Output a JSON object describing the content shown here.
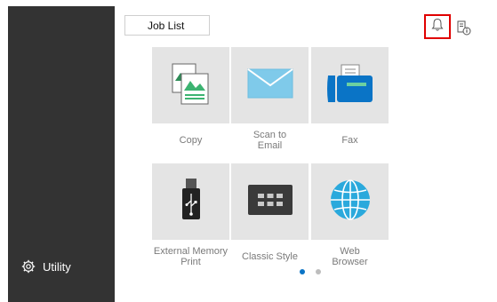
{
  "toolbar": {
    "job_list_label": "Job List"
  },
  "tiles": [
    {
      "label_lines": [
        "Copy"
      ],
      "icon": "copy-icon"
    },
    {
      "label_lines": [
        "Scan to",
        "Email"
      ],
      "icon": "mail-icon"
    },
    {
      "label_lines": [
        "Fax"
      ],
      "icon": "fax-icon"
    },
    {
      "label_lines": [
        "External Memory",
        "Print"
      ],
      "icon": "usb-icon"
    },
    {
      "label_lines": [
        "Classic Style"
      ],
      "icon": "classic-style-icon"
    },
    {
      "label_lines": [
        "Web",
        "Browser"
      ],
      "icon": "globe-icon"
    }
  ],
  "sidebar": {
    "utility_label": "Utility"
  },
  "pager": {
    "pages": 2,
    "current": 1
  },
  "colors": {
    "sidebar": "#333333",
    "tile": "#e4e4e4",
    "accent": "#0a74c6",
    "highlight": "#e00000"
  }
}
